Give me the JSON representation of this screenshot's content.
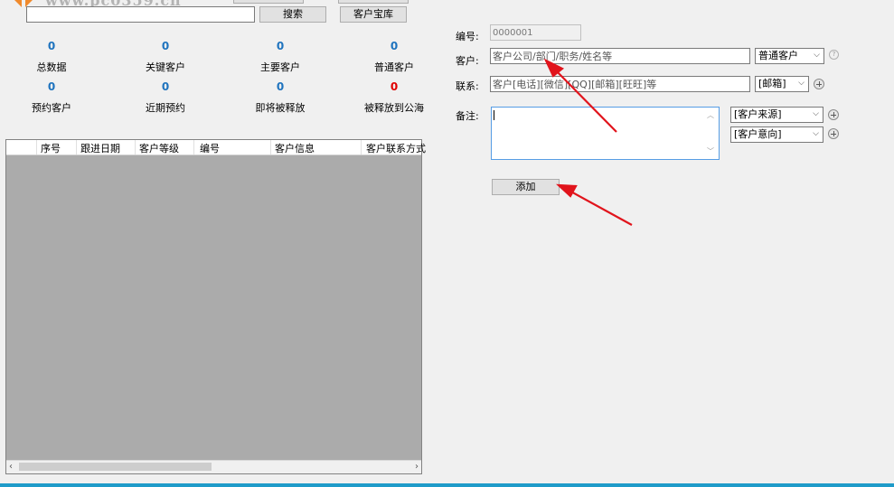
{
  "header": {
    "watermark": "www.pc0359.cn",
    "search_button": "搜索",
    "library_button": "客户宝库",
    "search_value": ""
  },
  "stats": [
    {
      "value": "0",
      "label": "总数据"
    },
    {
      "value": "0",
      "label": "关键客户"
    },
    {
      "value": "0",
      "label": "主要客户"
    },
    {
      "value": "0",
      "label": "普通客户"
    },
    {
      "value": "0",
      "label": "预约客户"
    },
    {
      "value": "0",
      "label": "近期预约"
    },
    {
      "value": "0",
      "label": "即将被释放"
    },
    {
      "value": "0",
      "label": "被释放到公海",
      "color": "#e00000"
    }
  ],
  "grid": {
    "columns": [
      "序号",
      "跟进日期",
      "客户等级",
      "编号",
      "客户信息",
      "客户联系方式"
    ]
  },
  "form": {
    "id_label": "编号:",
    "id_value": "0000001",
    "customer_label": "客户:",
    "customer_placeholder": "客户公司/部门/职务/姓名等",
    "customer_type": "普通客户",
    "contact_label": "联系:",
    "contact_placeholder": "客户[电话][微信][QQ][邮箱][旺旺]等",
    "contact_type": "[邮箱]",
    "note_label": "备注:",
    "note_value": "",
    "source_select": "[客户来源]",
    "intent_select": "[客户意向]",
    "add_button": "添加"
  },
  "colors": {
    "stat_blue": "#1e73be",
    "stat_red": "#e00000",
    "grid_bg": "#ababab",
    "accent_line": "#1f9bc9",
    "arrow_red": "#e1141c"
  },
  "icons": {
    "dropdown": "chevron-down-icon",
    "add": "plus-circle-icon",
    "help": "help-icon"
  }
}
